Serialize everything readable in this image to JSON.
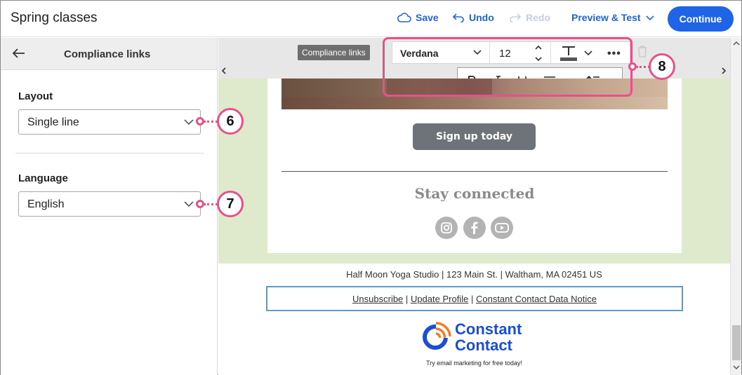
{
  "header": {
    "doc_title": "Spring classes",
    "save": "Save",
    "undo": "Undo",
    "redo": "Redo",
    "preview": "Preview & Test",
    "continue": "Continue"
  },
  "panel": {
    "title": "Compliance links",
    "layout_label": "Layout",
    "layout_value": "Single line",
    "language_label": "Language",
    "language_value": "English"
  },
  "callouts": {
    "c6": "6",
    "c7": "7",
    "c8": "8"
  },
  "toolbar": {
    "block_tag": "Compliance links",
    "font": "Verdana",
    "size": "12"
  },
  "email": {
    "button": "Sign up today",
    "stay_connected": "Stay connected",
    "social_icons": [
      "instagram-icon",
      "facebook-icon",
      "youtube-icon"
    ]
  },
  "footer": {
    "address": "Half Moon Yoga Studio | 123 Main St. | Waltham, MA 02451 US",
    "unsubscribe": "Unsubscribe",
    "update_profile": "Update Profile",
    "data_notice": "Constant Contact Data Notice",
    "sep": "|",
    "logo_line1": "Constant",
    "logo_line2": "Contact",
    "tagline": "Try email marketing for free today!"
  },
  "colors": {
    "accent": "#1f63e6",
    "callout": "#e8508b",
    "canvas_bg": "#dfe9cc"
  }
}
